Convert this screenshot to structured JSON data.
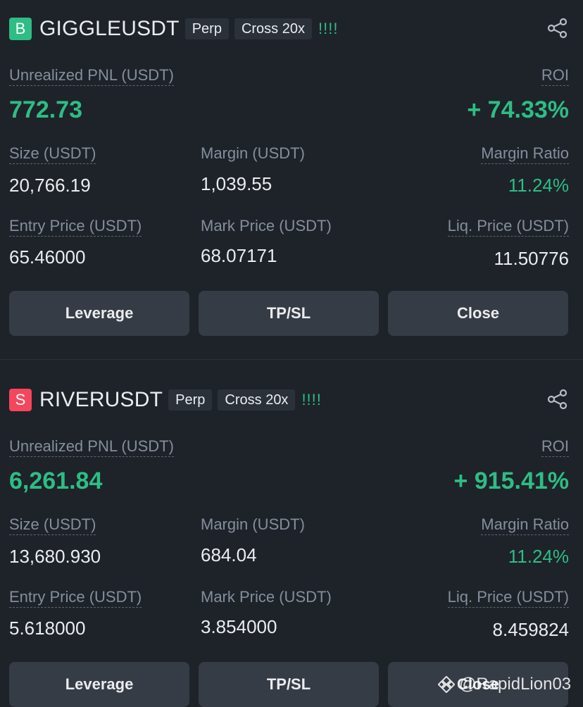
{
  "positions": [
    {
      "side": "B",
      "side_color": "#2ebd85",
      "symbol": "GIGGLEUSDT",
      "tag_type": "Perp",
      "tag_margin": "Cross 20x",
      "bars": "!!!!",
      "pnl_label": "Unrealized PNL (USDT)",
      "pnl_value": "772.73",
      "roi_label": "ROI",
      "roi_value": "+ 74.33%",
      "size_label": "Size (USDT)",
      "size_value": "20,766.19",
      "margin_label": "Margin (USDT)",
      "margin_value": "1,039.55",
      "margin_ratio_label": "Margin Ratio",
      "margin_ratio_value": "11.24%",
      "entry_label": "Entry Price (USDT)",
      "entry_value": "65.46000",
      "mark_label": "Mark Price (USDT)",
      "mark_value": "68.07171",
      "liq_label": "Liq. Price (USDT)",
      "liq_value": "11.50776",
      "buttons": [
        "Leverage",
        "TP/SL",
        "Close"
      ]
    },
    {
      "side": "S",
      "side_color": "#f6465d",
      "symbol": "RIVERUSDT",
      "tag_type": "Perp",
      "tag_margin": "Cross 20x",
      "bars": "!!!!",
      "pnl_label": "Unrealized PNL (USDT)",
      "pnl_value": "6,261.84",
      "roi_label": "ROI",
      "roi_value": "+ 915.41%",
      "size_label": "Size (USDT)",
      "size_value": "13,680.930",
      "margin_label": "Margin (USDT)",
      "margin_value": "684.04",
      "margin_ratio_label": "Margin Ratio",
      "margin_ratio_value": "11.24%",
      "entry_label": "Entry Price (USDT)",
      "entry_value": "5.618000",
      "mark_label": "Mark Price (USDT)",
      "mark_value": "3.854000",
      "liq_label": "Liq. Price (USDT)",
      "liq_value": "8.459824",
      "buttons": [
        "Leverage",
        "TP/SL",
        "Close"
      ]
    }
  ],
  "watermark": "@RapidLion03",
  "colors": {
    "background": "#1e2329",
    "positive": "#2ebd85",
    "negative": "#f6465d",
    "button": "#363c45"
  }
}
